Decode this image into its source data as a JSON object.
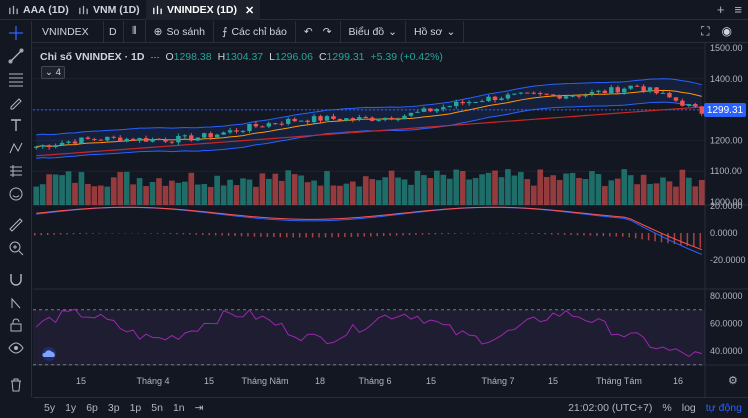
{
  "tabs": [
    {
      "label": "AAA (1D)",
      "active": false
    },
    {
      "label": "VNM (1D)",
      "active": false
    },
    {
      "label": "VNINDEX (1D)",
      "active": true
    }
  ],
  "tab_actions": {
    "add": "+",
    "menu": "≡"
  },
  "toolbar": {
    "symbol": "VNINDEX",
    "interval": "D",
    "compare_label": "So sánh",
    "indicators_label": "Các chỉ báo",
    "chart_type_label": "Biểu đồ",
    "profile_label": "Hồ sơ"
  },
  "legend": {
    "title": "Chỉ số VNINDEX · 1D",
    "o_label": "O",
    "o_value": "1298.38",
    "h_label": "H",
    "h_value": "1304.37",
    "l_label": "L",
    "l_value": "1296.06",
    "c_label": "C",
    "c_value": "1299.31",
    "change": "+5.39 (+0.42%)",
    "collapsed_count": "4"
  },
  "price_tag": "1299.31",
  "price_axis": [
    "1500.00",
    "1400.00",
    "1300.00",
    "1200.00",
    "1100.00",
    "1000.00"
  ],
  "macd_axis": [
    "20.0000",
    "0.0000",
    "-20.0000"
  ],
  "rsi_axis": [
    "80.0000",
    "60.0000",
    "40.0000"
  ],
  "time_axis": [
    "15",
    "Tháng 4",
    "15",
    "Tháng Năm",
    "18",
    "Tháng 6",
    "15",
    "Tháng 7",
    "15",
    "Tháng Tám",
    "16"
  ],
  "bottom": {
    "ranges": [
      "5y",
      "1y",
      "6p",
      "3p",
      "1p",
      "5n",
      "1n"
    ],
    "time": "21:02:00 (UTC+7)",
    "percent": "%",
    "log": "log",
    "auto": "tự động"
  },
  "colors": {
    "up": "#26a69a",
    "down": "#ef5350",
    "accent": "#2962ff",
    "bg": "#131722"
  }
}
